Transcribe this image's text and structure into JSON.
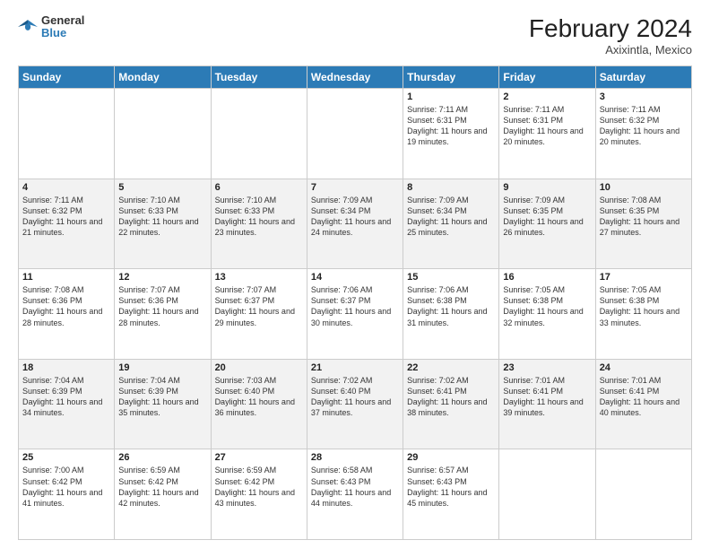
{
  "header": {
    "logo_general": "General",
    "logo_blue": "Blue",
    "month_year": "February 2024",
    "location": "Axixintla, Mexico"
  },
  "days_of_week": [
    "Sunday",
    "Monday",
    "Tuesday",
    "Wednesday",
    "Thursday",
    "Friday",
    "Saturday"
  ],
  "weeks": [
    [
      {
        "day": "",
        "info": ""
      },
      {
        "day": "",
        "info": ""
      },
      {
        "day": "",
        "info": ""
      },
      {
        "day": "",
        "info": ""
      },
      {
        "day": "1",
        "info": "Sunrise: 7:11 AM\nSunset: 6:31 PM\nDaylight: 11 hours and 19 minutes."
      },
      {
        "day": "2",
        "info": "Sunrise: 7:11 AM\nSunset: 6:31 PM\nDaylight: 11 hours and 20 minutes."
      },
      {
        "day": "3",
        "info": "Sunrise: 7:11 AM\nSunset: 6:32 PM\nDaylight: 11 hours and 20 minutes."
      }
    ],
    [
      {
        "day": "4",
        "info": "Sunrise: 7:11 AM\nSunset: 6:32 PM\nDaylight: 11 hours and 21 minutes."
      },
      {
        "day": "5",
        "info": "Sunrise: 7:10 AM\nSunset: 6:33 PM\nDaylight: 11 hours and 22 minutes."
      },
      {
        "day": "6",
        "info": "Sunrise: 7:10 AM\nSunset: 6:33 PM\nDaylight: 11 hours and 23 minutes."
      },
      {
        "day": "7",
        "info": "Sunrise: 7:09 AM\nSunset: 6:34 PM\nDaylight: 11 hours and 24 minutes."
      },
      {
        "day": "8",
        "info": "Sunrise: 7:09 AM\nSunset: 6:34 PM\nDaylight: 11 hours and 25 minutes."
      },
      {
        "day": "9",
        "info": "Sunrise: 7:09 AM\nSunset: 6:35 PM\nDaylight: 11 hours and 26 minutes."
      },
      {
        "day": "10",
        "info": "Sunrise: 7:08 AM\nSunset: 6:35 PM\nDaylight: 11 hours and 27 minutes."
      }
    ],
    [
      {
        "day": "11",
        "info": "Sunrise: 7:08 AM\nSunset: 6:36 PM\nDaylight: 11 hours and 28 minutes."
      },
      {
        "day": "12",
        "info": "Sunrise: 7:07 AM\nSunset: 6:36 PM\nDaylight: 11 hours and 28 minutes."
      },
      {
        "day": "13",
        "info": "Sunrise: 7:07 AM\nSunset: 6:37 PM\nDaylight: 11 hours and 29 minutes."
      },
      {
        "day": "14",
        "info": "Sunrise: 7:06 AM\nSunset: 6:37 PM\nDaylight: 11 hours and 30 minutes."
      },
      {
        "day": "15",
        "info": "Sunrise: 7:06 AM\nSunset: 6:38 PM\nDaylight: 11 hours and 31 minutes."
      },
      {
        "day": "16",
        "info": "Sunrise: 7:05 AM\nSunset: 6:38 PM\nDaylight: 11 hours and 32 minutes."
      },
      {
        "day": "17",
        "info": "Sunrise: 7:05 AM\nSunset: 6:38 PM\nDaylight: 11 hours and 33 minutes."
      }
    ],
    [
      {
        "day": "18",
        "info": "Sunrise: 7:04 AM\nSunset: 6:39 PM\nDaylight: 11 hours and 34 minutes."
      },
      {
        "day": "19",
        "info": "Sunrise: 7:04 AM\nSunset: 6:39 PM\nDaylight: 11 hours and 35 minutes."
      },
      {
        "day": "20",
        "info": "Sunrise: 7:03 AM\nSunset: 6:40 PM\nDaylight: 11 hours and 36 minutes."
      },
      {
        "day": "21",
        "info": "Sunrise: 7:02 AM\nSunset: 6:40 PM\nDaylight: 11 hours and 37 minutes."
      },
      {
        "day": "22",
        "info": "Sunrise: 7:02 AM\nSunset: 6:41 PM\nDaylight: 11 hours and 38 minutes."
      },
      {
        "day": "23",
        "info": "Sunrise: 7:01 AM\nSunset: 6:41 PM\nDaylight: 11 hours and 39 minutes."
      },
      {
        "day": "24",
        "info": "Sunrise: 7:01 AM\nSunset: 6:41 PM\nDaylight: 11 hours and 40 minutes."
      }
    ],
    [
      {
        "day": "25",
        "info": "Sunrise: 7:00 AM\nSunset: 6:42 PM\nDaylight: 11 hours and 41 minutes."
      },
      {
        "day": "26",
        "info": "Sunrise: 6:59 AM\nSunset: 6:42 PM\nDaylight: 11 hours and 42 minutes."
      },
      {
        "day": "27",
        "info": "Sunrise: 6:59 AM\nSunset: 6:42 PM\nDaylight: 11 hours and 43 minutes."
      },
      {
        "day": "28",
        "info": "Sunrise: 6:58 AM\nSunset: 6:43 PM\nDaylight: 11 hours and 44 minutes."
      },
      {
        "day": "29",
        "info": "Sunrise: 6:57 AM\nSunset: 6:43 PM\nDaylight: 11 hours and 45 minutes."
      },
      {
        "day": "",
        "info": ""
      },
      {
        "day": "",
        "info": ""
      }
    ]
  ]
}
